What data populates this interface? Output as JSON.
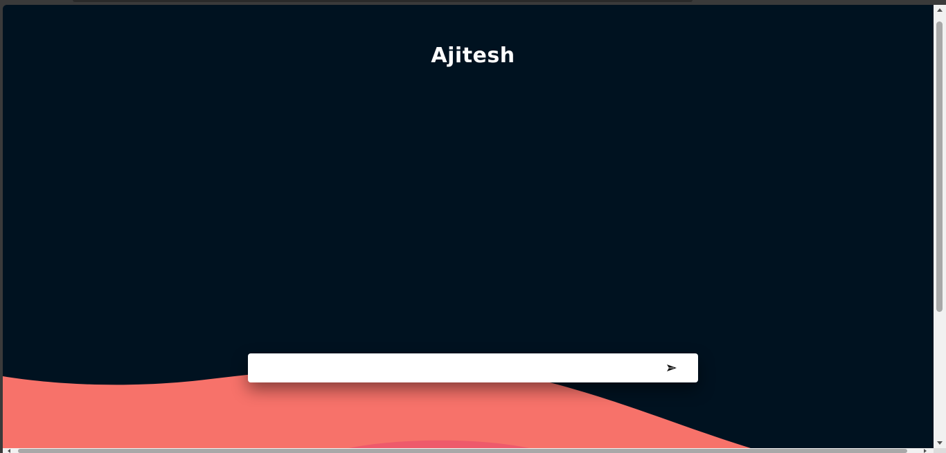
{
  "app": {
    "title": "Ajitesh"
  },
  "composer": {
    "input_value": "",
    "input_placeholder": "",
    "send_icon": "send-arrow-icon"
  },
  "colors": {
    "background": "#001220",
    "wave_primary": "#F7726A",
    "wave_secondary": "#EE5A6B",
    "input_bg": "#FFFFFF",
    "title_text": "#FFFFFF"
  }
}
